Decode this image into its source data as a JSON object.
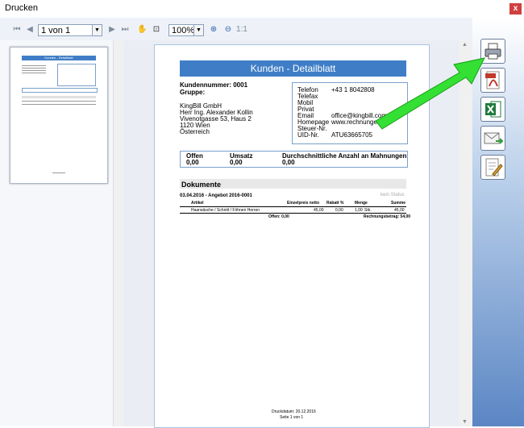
{
  "window": {
    "title": "Drucken",
    "close_label": "x"
  },
  "toolbar": {
    "page_selector": "1 von 1",
    "zoom_selector": "100%",
    "zoom_ratio": "1:1",
    "icons": [
      "first-page-icon",
      "prev-page-icon",
      "next-page-icon",
      "last-page-icon",
      "hand-icon",
      "select-icon",
      "zoom-in-icon",
      "zoom-out-icon"
    ]
  },
  "sidebar_actions": [
    "printer-icon",
    "pdf-icon",
    "excel-icon",
    "email-icon",
    "edit-icon"
  ],
  "document": {
    "title": "Kunden - Detailblatt",
    "customer_number": "Kundennummer: 0001",
    "group": "Gruppe:",
    "address": [
      "KingBill GmbH",
      "Herr Ing. Alexander Kollin",
      "Vivenotgasse 53, Haus 2",
      "1120 Wien",
      "Österreich"
    ],
    "contact": [
      {
        "label": "Telefon",
        "value": "+43 1 8042808"
      },
      {
        "label": "Telefax",
        "value": ""
      },
      {
        "label": "Mobil",
        "value": ""
      },
      {
        "label": "Privat",
        "value": ""
      },
      {
        "label": "Email",
        "value": "office@kingbill.com"
      },
      {
        "label": "Homepage",
        "value": "www.rechnungen.at"
      },
      {
        "label": "Steuer-Nr.",
        "value": ""
      },
      {
        "label": "UID-Nr.",
        "value": "ATU63665705"
      }
    ],
    "summary_headers": {
      "open": "Offen",
      "sales": "Umsatz",
      "reminders": "Durchschnittliche Anzahl an Mahnungen"
    },
    "summary_values": {
      "open": "0,00",
      "sales": "0,00",
      "reminders": "0,00"
    },
    "documents_title": "Dokumente",
    "status_label": "kein Status",
    "offer_line": "03.04.2016 - Angebot 2016-0001",
    "table_headers": {
      "article": "Artikel",
      "unit_price": "Einzelpreis netto",
      "discount": "Rabatt %",
      "quantity": "Menge",
      "sum": "Summe"
    },
    "table_row": {
      "article": "Haarwäsche / Schnitt / Föhnen Herren",
      "unit_price": "45,00",
      "discount": "0,00",
      "quantity": "1,00",
      "unit": "Stk.",
      "sum": "45,00"
    },
    "open_total": "Offen: 0,00",
    "invoice_total": "Rechnungsbetrag: 54,00",
    "print_date": "Druckdatum: 20.12.2016",
    "page_label": "Seite 1 von 1"
  },
  "thumbnail": {
    "title": "Kunden - Detailblatt"
  }
}
